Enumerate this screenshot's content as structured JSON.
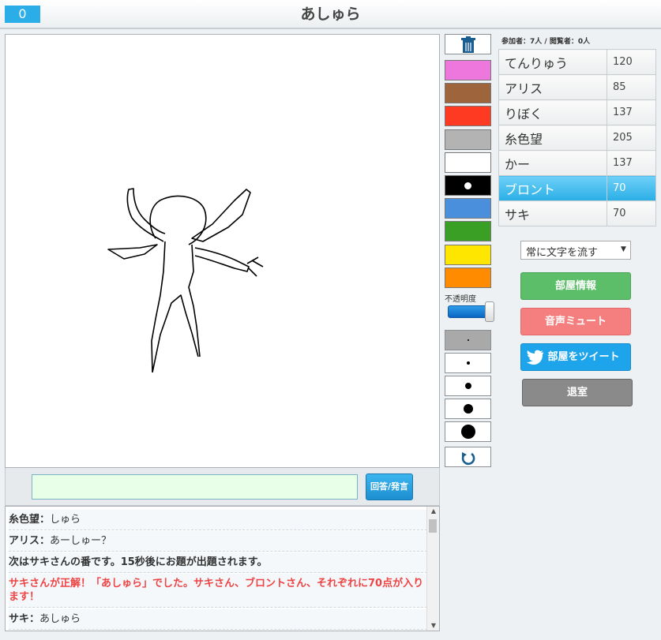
{
  "header": {
    "counter": "0",
    "title": "あしゅら"
  },
  "answer": {
    "value": "",
    "button_label": "回答/発言"
  },
  "chat": [
    {
      "name": "糸色望",
      "sep": "：",
      "text": "しゅら",
      "type": "user"
    },
    {
      "name": "アリス",
      "sep": "：",
      "text": "あーしゅー？",
      "type": "user"
    },
    {
      "text": "次はサキさんの番です。15秒後にお題が出題されます。",
      "type": "system"
    },
    {
      "text": "サキさんが正解！「あしゅら」でした。サキさん、ブロントさん、それぞれに70点が入ります！",
      "type": "correct"
    },
    {
      "name": "サキ",
      "sep": "：",
      "text": "あしゅら",
      "type": "user"
    }
  ],
  "tools": {
    "colors": [
      "#ee77dd",
      "#9e643c",
      "#ff3a22",
      "#b3b3b3",
      "#ffffff",
      "#000000",
      "#4a8fdc",
      "#3aa025",
      "#ffe600",
      "#ff8c00"
    ],
    "selected_color_index": 5,
    "opacity_label": "不透明度",
    "opacity_level": 0.95,
    "pen_sizes": [
      2,
      4,
      8,
      12,
      18
    ],
    "selected_size_index": 0
  },
  "right": {
    "participants": "参加者：7人 / 閲覧者：0人",
    "players": [
      {
        "name": "てんりゅう",
        "score": "120"
      },
      {
        "name": "アリス",
        "score": "85"
      },
      {
        "name": "りぼく",
        "score": "137"
      },
      {
        "name": "糸色望",
        "score": "205"
      },
      {
        "name": "かー",
        "score": "137"
      },
      {
        "name": "ブロント",
        "score": "70"
      },
      {
        "name": "サキ",
        "score": "70"
      }
    ],
    "highlighted_player_index": 5,
    "flow_option": "常に文字を流す",
    "room_info": "部屋情報",
    "mute": "音声ミュート",
    "tweet": "部屋をツイート",
    "exit": "退室"
  },
  "colors": {
    "accent": "#2baee8",
    "green": "#5cbe69",
    "red": "#f57f7f",
    "twitter": "#1ea4ea",
    "gray": "#8a8a8a"
  }
}
